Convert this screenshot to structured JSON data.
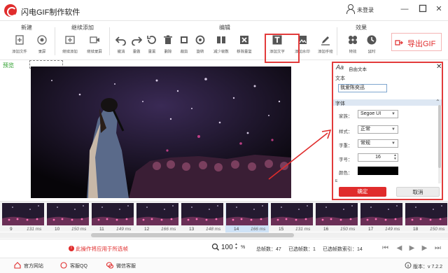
{
  "app": {
    "title": "闪电GIF制作软件",
    "user_label": "未登录"
  },
  "toolbar": {
    "groups": [
      {
        "title": "新建",
        "buttons": [
          {
            "label": "添加文件",
            "icon": "add-file-icon"
          },
          {
            "label": "录屏",
            "icon": "record-screen-icon"
          }
        ]
      },
      {
        "title": "继续添加",
        "buttons": [
          {
            "label": "继续添加",
            "icon": "continue-add-icon"
          },
          {
            "label": "继续录屏",
            "icon": "continue-record-icon"
          }
        ]
      },
      {
        "title": "编辑",
        "buttons": [
          {
            "label": "撤消",
            "icon": "undo-icon"
          },
          {
            "label": "重做",
            "icon": "redo-icon"
          },
          {
            "label": "重置",
            "icon": "reset-icon"
          },
          {
            "label": "删除",
            "icon": "delete-icon"
          },
          {
            "label": "裁剪",
            "icon": "crop-icon"
          },
          {
            "label": "旋转",
            "icon": "rotate-icon"
          },
          {
            "label": "减少帧数",
            "icon": "reduce-frames-icon"
          },
          {
            "label": "移除重复",
            "icon": "remove-duplicates-icon"
          },
          {
            "label": "添加文字",
            "icon": "add-text-icon"
          },
          {
            "label": "添加水印",
            "icon": "add-watermark-icon"
          },
          {
            "label": "添加手绘",
            "icon": "add-drawing-icon"
          }
        ]
      },
      {
        "title": "效果",
        "buttons": [
          {
            "label": "特效",
            "icon": "effects-icon"
          },
          {
            "label": "延时",
            "icon": "delay-icon"
          }
        ]
      }
    ],
    "export_label": "导出GIF"
  },
  "preview": {
    "label": "预览"
  },
  "text_panel": {
    "title": "自由文本",
    "text_section": "文本",
    "text_value": "我爱陈奕迅",
    "font_section": "字体",
    "family_label": "家族：",
    "family_value": "Segoe UI",
    "style_label": "样式：",
    "style_value": "正常",
    "weight_label": "字重：",
    "weight_value": "常规",
    "size_label": "字号：",
    "size_value": "16",
    "color_label": "颜色：",
    "color_value": "#000000",
    "next_section": "E",
    "ok_label": "确定",
    "cancel_label": "取消"
  },
  "filmstrip": {
    "frames": [
      {
        "index": "9",
        "ms": "131 ms"
      },
      {
        "index": "10",
        "ms": "150 ms"
      },
      {
        "index": "11",
        "ms": "149 ms"
      },
      {
        "index": "12",
        "ms": "166 ms"
      },
      {
        "index": "13",
        "ms": "148 ms"
      },
      {
        "index": "14",
        "ms": "166 ms"
      },
      {
        "index": "15",
        "ms": "131 ms"
      },
      {
        "index": "16",
        "ms": "150 ms"
      },
      {
        "index": "17",
        "ms": "149 ms"
      },
      {
        "index": "18",
        "ms": "150 ms"
      }
    ],
    "selected_index": "14"
  },
  "statusbar": {
    "warning": "此操作将应用于所选帧",
    "zoom": "100",
    "zoom_unit": "%",
    "total_frames": "总帧数：47",
    "selected_frames": "已选帧数：1",
    "selected_index": "已选帧数索引：14"
  },
  "footer": {
    "website": "官方网站",
    "qq": "客服QQ",
    "wechat": "微信客服",
    "version": "版本：v 7.2.2"
  },
  "colors": {
    "accent": "#e02c2c",
    "selection": "#cfe3f7"
  }
}
